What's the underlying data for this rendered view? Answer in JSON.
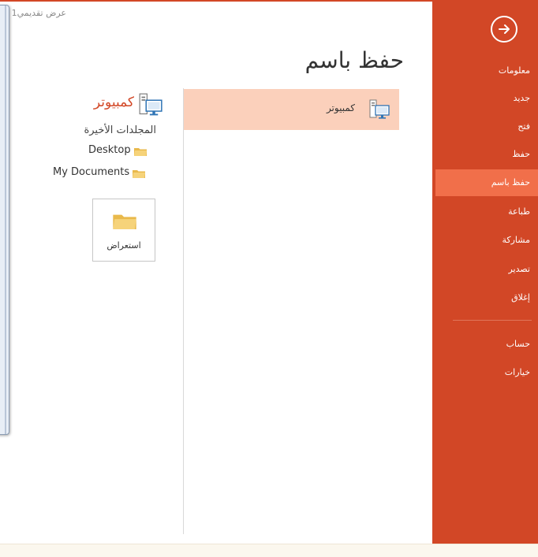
{
  "window": {
    "title": "عرض تقديمي1"
  },
  "sidebar": {
    "items": [
      {
        "label": "معلومات"
      },
      {
        "label": "جديد"
      },
      {
        "label": "فتح"
      },
      {
        "label": "حفظ"
      },
      {
        "label": "حفظ باسم",
        "active": true
      },
      {
        "label": "طباعة"
      },
      {
        "label": "مشاركة"
      },
      {
        "label": "تصدير"
      },
      {
        "label": "إغلاق"
      }
    ],
    "bottom_items": [
      {
        "label": "حساب"
      },
      {
        "label": "خيارات"
      }
    ]
  },
  "main": {
    "title": "حفظ باسم",
    "places": [
      {
        "label": "كمبيوتر",
        "selected": true
      }
    ],
    "detail": {
      "title": "كمبيوتر",
      "recent_heading": "المجلدات الأخيرة",
      "folders": [
        {
          "label": "Desktop"
        },
        {
          "label": "My Documents"
        }
      ],
      "browse_label": "استعراض"
    }
  },
  "colors": {
    "accent": "#d24726",
    "active_item": "#f16f4a",
    "selected_place": "#fbd0bb",
    "folder": "#f3c868"
  },
  "icons": {
    "back": "back-arrow-icon",
    "computer": "computer-icon",
    "folder": "folder-icon"
  }
}
